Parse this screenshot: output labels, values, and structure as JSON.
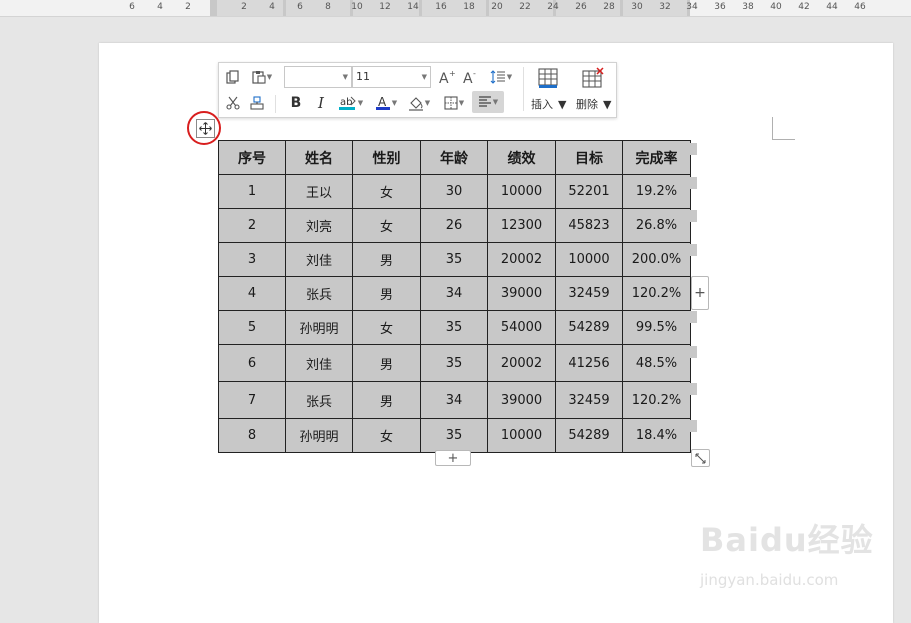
{
  "ruler": {
    "numbers": [
      "6",
      "4",
      "2",
      "2",
      "4",
      "6",
      "8",
      "10",
      "12",
      "14",
      "16",
      "18",
      "20",
      "22",
      "24",
      "26",
      "28",
      "30",
      "32",
      "34",
      "36",
      "38",
      "40",
      "42",
      "44",
      "46"
    ]
  },
  "toolbar": {
    "font_name_value": "",
    "font_size_value": "11",
    "insert_label": "插入",
    "delete_label": "删除",
    "icons": [
      "copy-icon",
      "paste-icon",
      "cut-icon",
      "format-painter-icon",
      "grow-font-icon",
      "shrink-font-icon",
      "line-spacing-icon",
      "bold-icon",
      "italic-icon",
      "highlight-icon",
      "font-color-icon",
      "shading-icon",
      "borders-icon",
      "align-icon",
      "insert-table-icon",
      "delete-table-icon"
    ],
    "colors": {
      "highlight": "#00b0c8",
      "font_color": "#1e3cc8"
    }
  },
  "table": {
    "headers": [
      "序号",
      "姓名",
      "性别",
      "年龄",
      "绩效",
      "目标",
      "完成率"
    ],
    "rows": [
      [
        "1",
        "王以",
        "女",
        "30",
        "10000",
        "52201",
        "19.2%"
      ],
      [
        "2",
        "刘亮",
        "女",
        "26",
        "12300",
        "45823",
        "26.8%"
      ],
      [
        "3",
        "刘佳",
        "男",
        "35",
        "20002",
        "10000",
        "200.0%"
      ],
      [
        "4",
        "张兵",
        "男",
        "34",
        "39000",
        "32459",
        "120.2%"
      ],
      [
        "5",
        "孙明明",
        "女",
        "35",
        "54000",
        "54289",
        "99.5%"
      ],
      [
        "6",
        "刘佳",
        "男",
        "35",
        "20002",
        "41256",
        "48.5%"
      ],
      [
        "7",
        "张兵",
        "男",
        "34",
        "39000",
        "32459",
        "120.2%"
      ],
      [
        "8",
        "孙明明",
        "女",
        "35",
        "10000",
        "54289",
        "18.4%"
      ]
    ]
  },
  "controls": {
    "add_col": "+",
    "add_row": "+"
  },
  "watermark": {
    "main": "Baidu经验",
    "sub": "jingyan.baidu.com"
  },
  "colors": {
    "cell_bg": "#c8c8c8",
    "highlight_ring": "#d81e1e"
  }
}
